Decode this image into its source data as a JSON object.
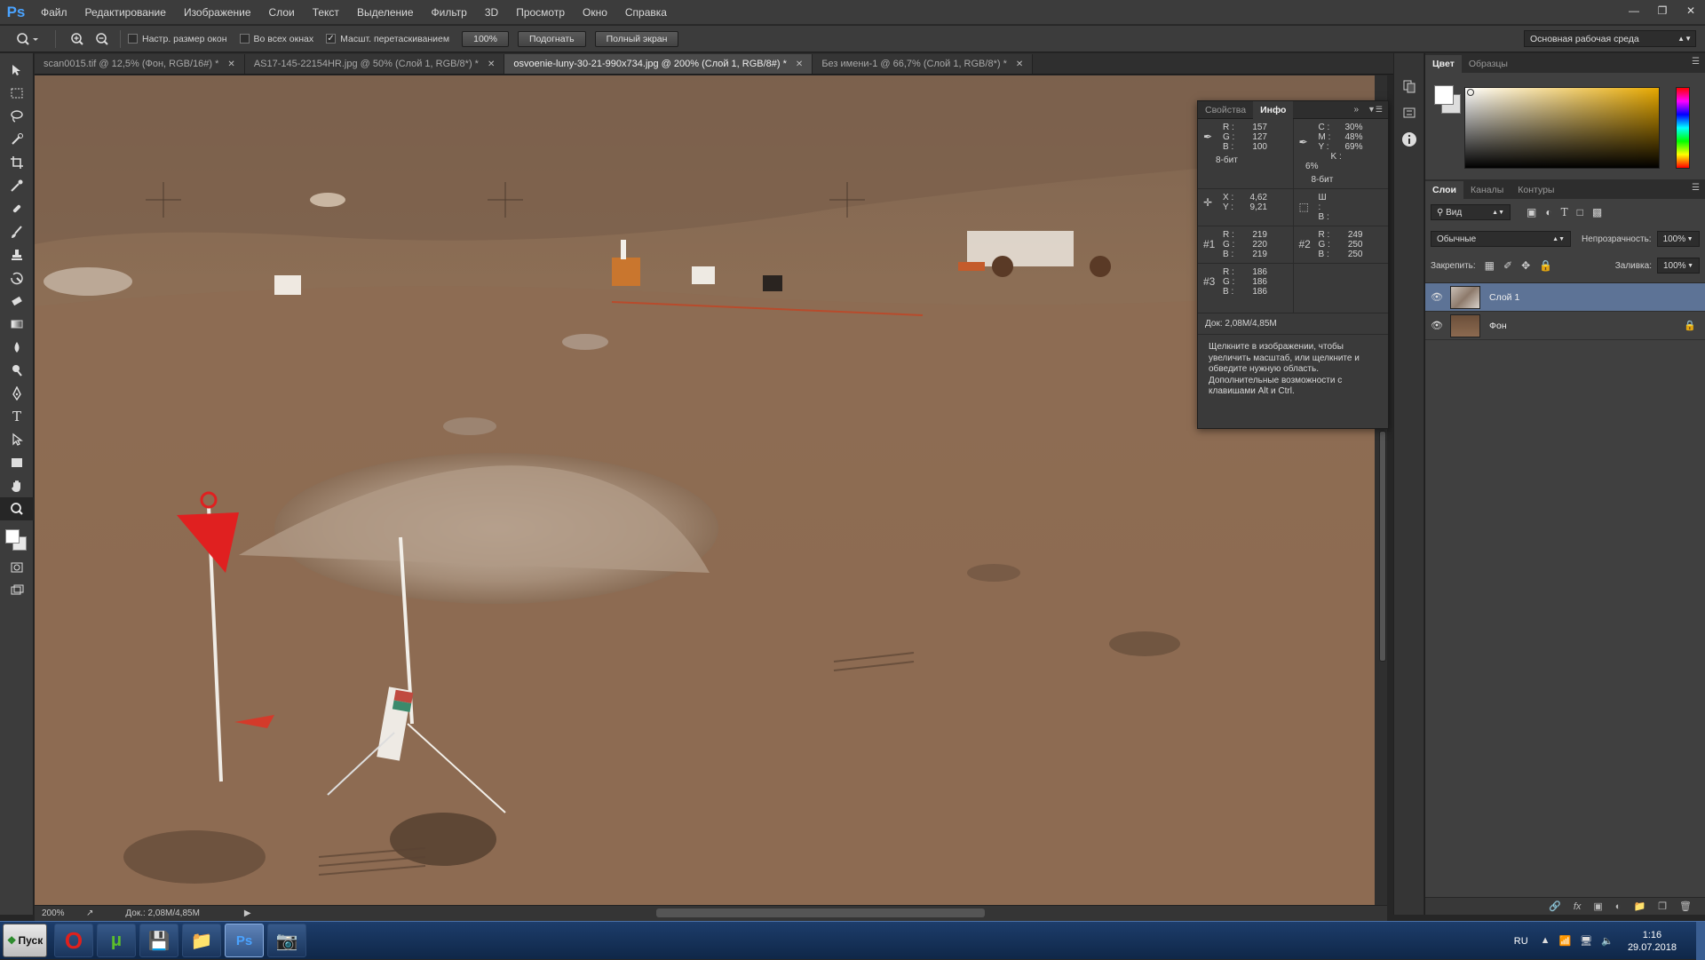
{
  "app": {
    "logo": "Ps"
  },
  "menu": [
    "Файл",
    "Редактирование",
    "Изображение",
    "Слои",
    "Текст",
    "Выделение",
    "Фильтр",
    "3D",
    "Просмотр",
    "Окно",
    "Справка"
  ],
  "options": {
    "resize_windows": "Настр. размер окон",
    "all_windows": "Во всех окнах",
    "scrubby_zoom": "Масшт. перетаскиванием",
    "zoom_100": "100%",
    "fit": "Подогнать",
    "fullscreen": "Полный экран",
    "workspace": "Основная рабочая среда"
  },
  "tabs": [
    {
      "label": "scan0015.tif @ 12,5% (Фон, RGB/16#) *"
    },
    {
      "label": "AS17-145-22154HR.jpg @ 50% (Слой 1, RGB/8*) *"
    },
    {
      "label": "osvoenie-luny-30-21-990x734.jpg @ 200% (Слой 1, RGB/8#) *"
    },
    {
      "label": "Без имени-1 @ 66,7% (Слой 1, RGB/8*) *"
    }
  ],
  "info_panel": {
    "tabs": [
      "Свойства",
      "Инфо"
    ],
    "rgb": {
      "r": "157",
      "g": "127",
      "b": "100"
    },
    "cmyk": {
      "c": "30%",
      "m": "48%",
      "y": "69%",
      "k": "6%"
    },
    "bits_left": "8-бит",
    "bits_right": "8-бит",
    "xy": {
      "x": "4,62",
      "y": "9,21"
    },
    "wh": {
      "w": "",
      "h": ""
    },
    "s1": {
      "label": "#1",
      "r": "219",
      "g": "220",
      "b": "219"
    },
    "s2": {
      "label": "#2",
      "r": "249",
      "g": "250",
      "b": "250"
    },
    "s3": {
      "label": "#3",
      "r": "186",
      "g": "186",
      "b": "186"
    },
    "doc": "Док: 2,08M/4,85M",
    "hint": "Щелкните в изображении, чтобы увеличить масштаб, или щелкните и обведите нужную область. Дополнительные возможности с клавишами Alt и Ctrl."
  },
  "color_panel": {
    "tabs": [
      "Цвет",
      "Образцы"
    ]
  },
  "layers_panel": {
    "tabs": [
      "Слои",
      "Каналы",
      "Контуры"
    ],
    "filter": "Вид",
    "blend": "Обычные",
    "opacity_label": "Непрозрачность:",
    "opacity": "100%",
    "lock_label": "Закрепить:",
    "fill_label": "Заливка:",
    "fill": "100%",
    "layers": [
      {
        "name": "Слой 1"
      },
      {
        "name": "Фон"
      }
    ]
  },
  "status": {
    "zoom": "200%",
    "doc": "Док.: 2,08M/4,85M"
  },
  "taskbar": {
    "start": "Пуск",
    "lang": "RU",
    "time": "1:16",
    "date": "29.07.2018"
  }
}
